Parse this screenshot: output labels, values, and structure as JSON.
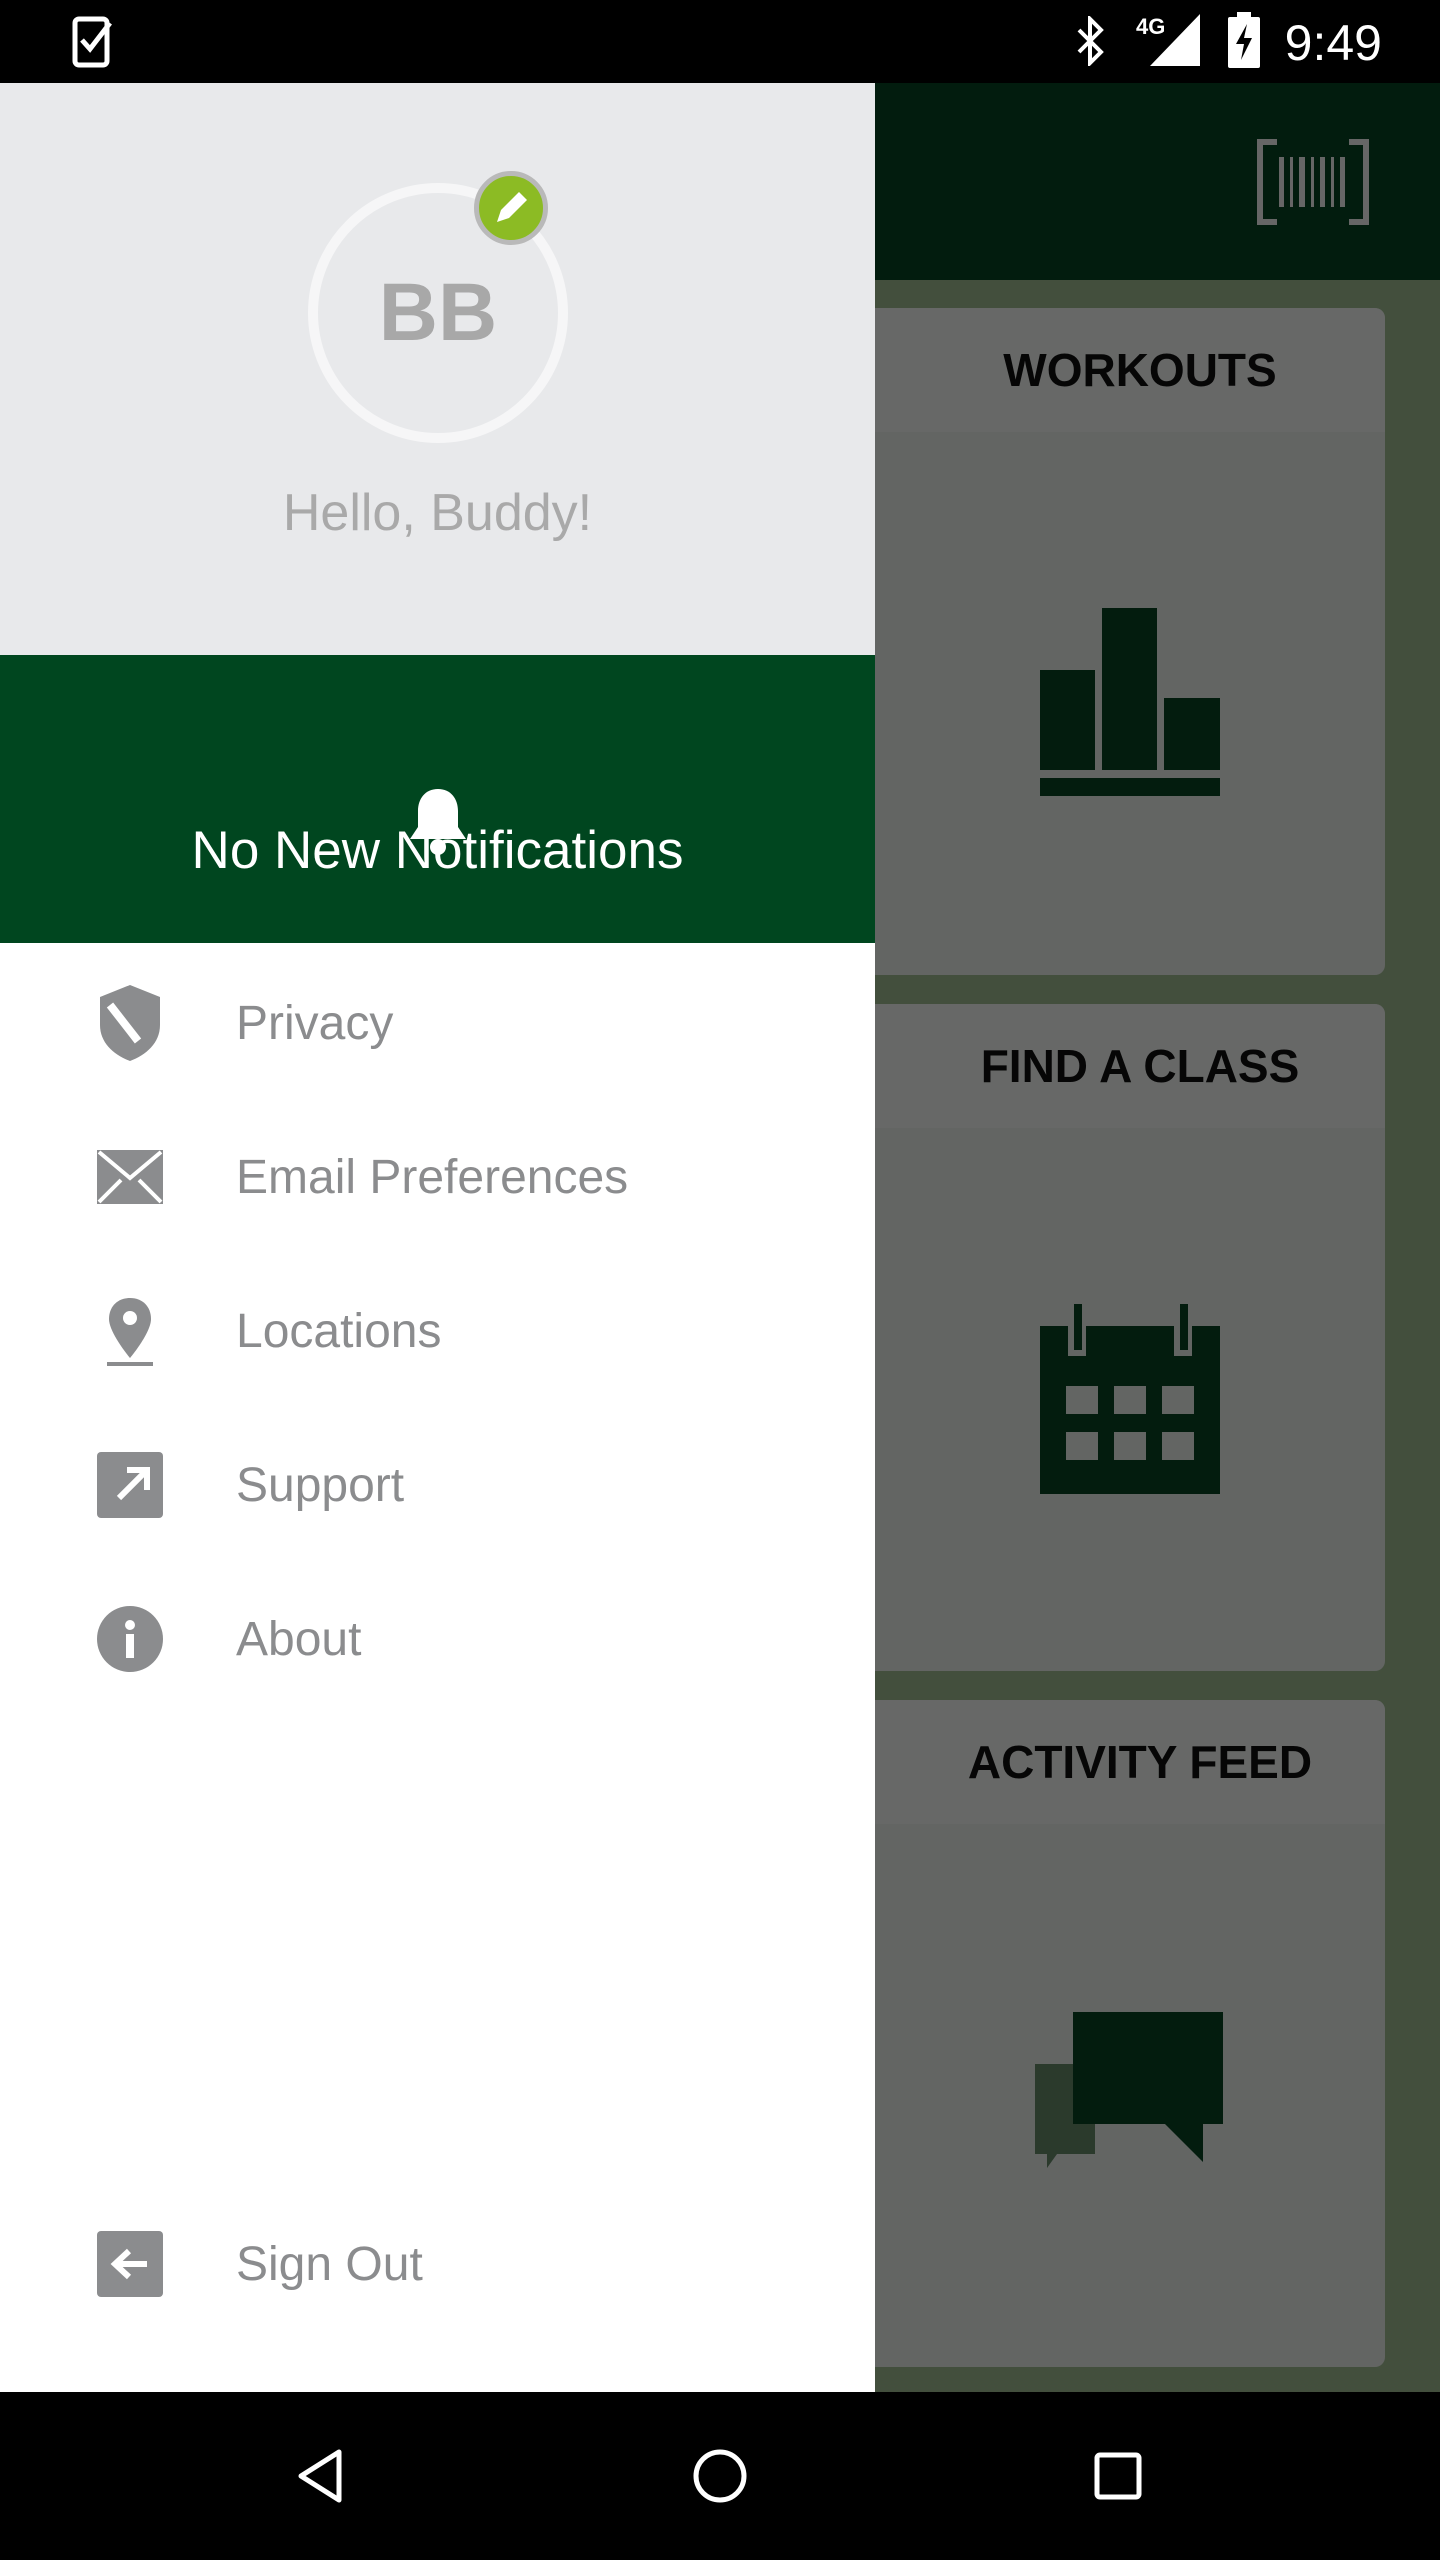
{
  "status_bar": {
    "time": "9:49",
    "network": "4G",
    "icons": [
      "task-check-icon",
      "bluetooth-icon",
      "signal-icon",
      "battery-charging-icon"
    ]
  },
  "drawer": {
    "avatar_initials": "BB",
    "greeting": "Hello, Buddy!",
    "notifications": "No New Notifications",
    "items": [
      {
        "label": "Privacy",
        "icon": "shield-icon"
      },
      {
        "label": "Email Preferences",
        "icon": "envelope-icon"
      },
      {
        "label": "Locations",
        "icon": "map-pin-icon"
      },
      {
        "label": "Support",
        "icon": "external-link-icon"
      },
      {
        "label": "About",
        "icon": "info-icon"
      }
    ],
    "sign_out": "Sign Out"
  },
  "main": {
    "cards": [
      {
        "title": "WORKOUTS",
        "icon": "bar-chart-icon"
      },
      {
        "title": "FIND A CLASS",
        "icon": "calendar-icon"
      },
      {
        "title": "ACTIVITY FEED",
        "icon": "chat-bubbles-icon"
      }
    ]
  },
  "colors": {
    "brand_green": "#00461f",
    "accent_green": "#8cbb24",
    "icon_gray": "#8b8c8e"
  }
}
